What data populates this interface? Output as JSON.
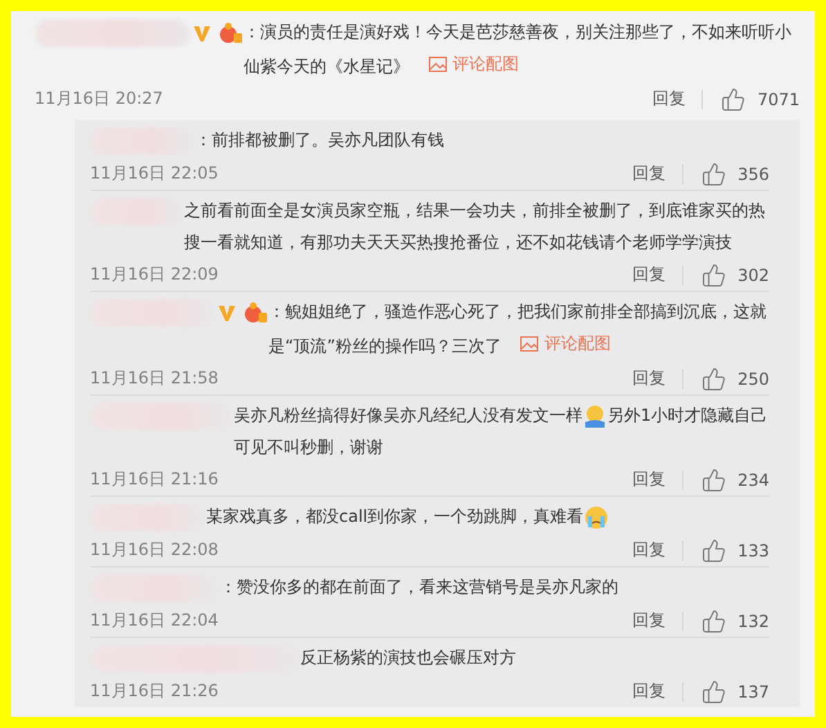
{
  "comment": {
    "badges": true,
    "parts": [
      {
        "kind": "text",
        "text": "：演员的责任是演好戏！今天是芭莎慈善夜，别关注那些了，不如来听听小仙紫今天的《水星记》"
      }
    ],
    "picture_link": "评论配图",
    "date": "11月16日 20:27",
    "reply_label": "回复",
    "likes": "7071"
  },
  "replies": [
    {
      "badges": false,
      "parts": [
        {
          "kind": "text",
          "text": "：前排都被删了。吴亦凡团队有钱"
        }
      ],
      "date": "11月16日 22:05",
      "reply_label": "回复",
      "likes": "356"
    },
    {
      "badges": false,
      "parts": [
        {
          "kind": "text",
          "text": "之前看前面全是女演员家空瓶，结果一会功夫，前排全被删了，到底谁家买的热搜一看就知道，有那功夫天天买热搜抢番位，还不如花钱请个老师学学演技"
        }
      ],
      "date": "11月16日 22:09",
      "reply_label": "回复",
      "likes": "302"
    },
    {
      "badges": true,
      "parts": [
        {
          "kind": "text",
          "text": "：鲵姐姐绝了，骚造作恶心死了，把我们家前排全部搞到沉底，这就是“顶流”粉丝的操作吗？三次了"
        }
      ],
      "picture_link": "评论配图",
      "date": "11月16日 21:58",
      "reply_label": "回复",
      "likes": "250"
    },
    {
      "badges": false,
      "parts": [
        {
          "kind": "text",
          "text": "吴亦凡粉丝搞得好像吴亦凡经纪人没有发文一样"
        },
        {
          "kind": "hug"
        },
        {
          "kind": "text",
          "text": "另外1小时才隐藏自己可见不叫秒删，谢谢"
        }
      ],
      "date": "11月16日 21:16",
      "reply_label": "回复",
      "likes": "234"
    },
    {
      "badges": false,
      "parts": [
        {
          "kind": "text",
          "text": "某家戏真多，都没call到你家，一个劲跳脚，真难看"
        },
        {
          "kind": "cry"
        }
      ],
      "date": "11月16日 22:08",
      "reply_label": "回复",
      "likes": "133"
    },
    {
      "badges": false,
      "parts": [
        {
          "kind": "text",
          "text": "：赞没你多的都在前面了，看来这营销号是吴亦凡家的"
        }
      ],
      "date": "11月16日 22:04",
      "reply_label": "回复",
      "likes": "132"
    },
    {
      "badges": false,
      "parts": [
        {
          "kind": "text",
          "text": "反正杨紫的演技也会碾压对方"
        }
      ],
      "date": "11月16日 21:26",
      "reply_label": "回复",
      "likes": "137"
    }
  ]
}
